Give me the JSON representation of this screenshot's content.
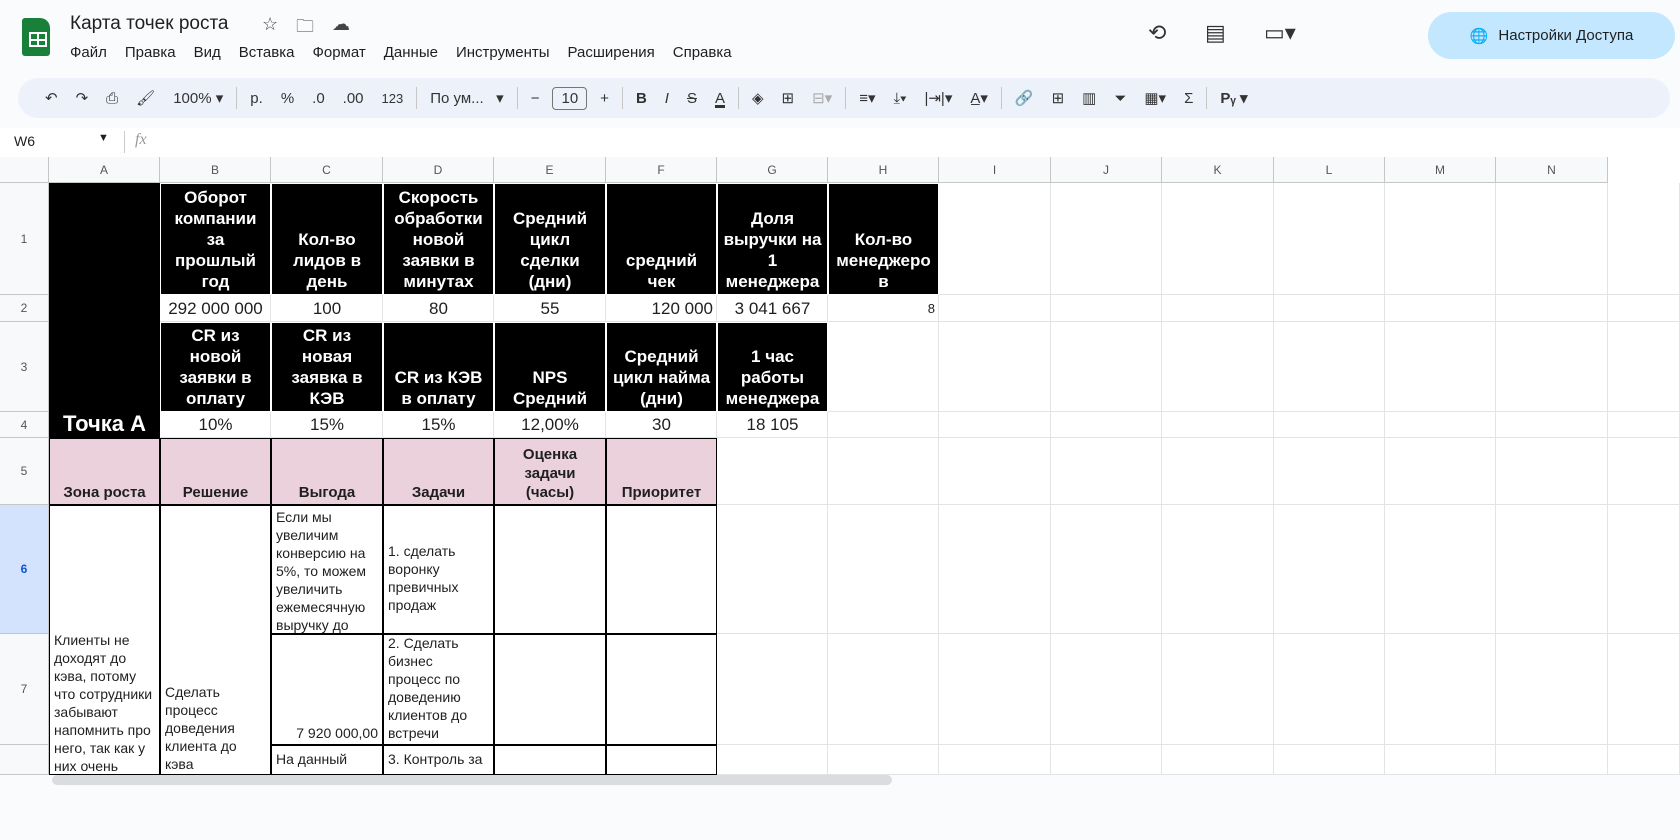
{
  "app": {
    "title": "Карта точек роста",
    "menu": [
      "Файл",
      "Правка",
      "Вид",
      "Вставка",
      "Формат",
      "Данные",
      "Инструменты",
      "Расширения",
      "Справка"
    ],
    "share_label": "Настройки Доступа"
  },
  "toolbar": {
    "zoom": "100%",
    "currency": "р.",
    "percent": "%",
    "dec_less": ".0",
    "dec_more": ".00",
    "number_format": "123",
    "font": "По ум...",
    "font_size": "10"
  },
  "formula_bar": {
    "cell_ref": "W6",
    "fx": "fx",
    "value": ""
  },
  "columns": [
    "A",
    "B",
    "C",
    "D",
    "E",
    "F",
    "G",
    "H",
    "I",
    "J",
    "K",
    "L",
    "M",
    "N"
  ],
  "rows": [
    "1",
    "2",
    "3",
    "4",
    "5",
    "6",
    "7"
  ],
  "selected_row": "6",
  "cells": [
    {
      "ref": "A1:A4",
      "text": "Точка А"
    },
    {
      "ref": "B1",
      "text": "Оборот компании за прошлый год"
    },
    {
      "ref": "C1",
      "text": "Кол-во лидов в день"
    },
    {
      "ref": "D1",
      "text": "Скорость обработки новой заявки в минутах"
    },
    {
      "ref": "E1",
      "text": "Средний цикл сделки (дни)"
    },
    {
      "ref": "F1",
      "text": "средний чек"
    },
    {
      "ref": "G1",
      "text": "Доля выручки на 1 менеджера"
    },
    {
      "ref": "H1",
      "text": "Кол-во менеджеров"
    },
    {
      "ref": "B2",
      "text": "292 000 000"
    },
    {
      "ref": "C2",
      "text": "100"
    },
    {
      "ref": "D2",
      "text": "80"
    },
    {
      "ref": "E2",
      "text": "55"
    },
    {
      "ref": "F2",
      "text": "120 000"
    },
    {
      "ref": "G2",
      "text": "3 041 667"
    },
    {
      "ref": "H2",
      "text": "8"
    },
    {
      "ref": "B3",
      "text": "CR из новой заявки в оплату"
    },
    {
      "ref": "C3",
      "text": "CR из новая заявка в КЭВ"
    },
    {
      "ref": "D3",
      "text": "CR из КЭВ в оплату"
    },
    {
      "ref": "E3",
      "text": "NPS Средний"
    },
    {
      "ref": "F3",
      "text": "Средний цикл найма (дни)"
    },
    {
      "ref": "G3",
      "text": "1 час работы менеджера"
    },
    {
      "ref": "B4",
      "text": "10%"
    },
    {
      "ref": "C4",
      "text": "15%"
    },
    {
      "ref": "D4",
      "text": "15%"
    },
    {
      "ref": "E4",
      "text": "12,00%"
    },
    {
      "ref": "F4",
      "text": "30"
    },
    {
      "ref": "G4",
      "text": "18 105"
    },
    {
      "ref": "A5",
      "text": "Зона роста"
    },
    {
      "ref": "B5",
      "text": "Решение"
    },
    {
      "ref": "C5",
      "text": "Выгода"
    },
    {
      "ref": "D5",
      "text": "Задачи"
    },
    {
      "ref": "E5",
      "text": "Оценка задачи (часы)"
    },
    {
      "ref": "F5",
      "text": "Приоритет"
    },
    {
      "ref": "A6:A8",
      "text": "Клиенты не доходят до кэва, потому что сотрудники забывают напомнить про него, так как у них очень"
    },
    {
      "ref": "B6:B8",
      "text": "Сделать процесс доведения клиента до кэва"
    },
    {
      "ref": "C6",
      "text": "Если мы увеличим конверсию на 5%, то можем увеличить ежемесячную выручку до"
    },
    {
      "ref": "D6",
      "text": "1. сделать воронку превичных продаж"
    },
    {
      "ref": "E6",
      "text": ""
    },
    {
      "ref": "F6",
      "text": ""
    },
    {
      "ref": "C7",
      "text": "7 920 000,00"
    },
    {
      "ref": "D7",
      "text": "2. Сделать бизнес процесс по доведению клиентов до встречи"
    },
    {
      "ref": "E7",
      "text": ""
    },
    {
      "ref": "F7",
      "text": ""
    },
    {
      "ref": "C8",
      "text": "На данный момент"
    },
    {
      "ref": "D8",
      "text": "3. Контроль за"
    },
    {
      "ref": "E8",
      "text": ""
    },
    {
      "ref": "F8",
      "text": ""
    }
  ]
}
